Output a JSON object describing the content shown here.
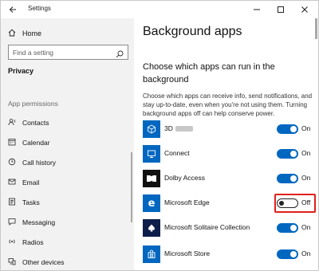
{
  "window": {
    "title": "Settings",
    "icons": {
      "back": "back-arrow-icon",
      "minimize": "minimize-icon",
      "maximize": "maximize-icon",
      "close": "close-icon"
    }
  },
  "sidebar": {
    "home": {
      "label": "Home",
      "icon": "home-icon"
    },
    "search": {
      "placeholder": "Find a setting",
      "icon": "search-icon"
    },
    "category": "Privacy",
    "section": "App permissions",
    "items": [
      {
        "label": "Contacts",
        "icon": "contacts-icon"
      },
      {
        "label": "Calendar",
        "icon": "calendar-icon"
      },
      {
        "label": "Call history",
        "icon": "call-history-icon"
      },
      {
        "label": "Email",
        "icon": "email-icon"
      },
      {
        "label": "Tasks",
        "icon": "tasks-icon"
      },
      {
        "label": "Messaging",
        "icon": "messaging-icon"
      },
      {
        "label": "Radios",
        "icon": "radios-icon"
      },
      {
        "label": "Other devices",
        "icon": "other-devices-icon"
      }
    ]
  },
  "main": {
    "title": "Background apps",
    "heading": "Choose which apps can run in the background",
    "description": "Choose which apps can receive info, send notifications, and stay up-to-date, even when you're not using them. Turning background apps off can help conserve power.",
    "apps": [
      {
        "name": "3D",
        "state": "On",
        "enabled": true,
        "tile_color": "#0067c0",
        "icon": "3d-viewer-icon"
      },
      {
        "name": "Connect",
        "state": "On",
        "enabled": true,
        "tile_color": "#0067c0",
        "icon": "connect-icon"
      },
      {
        "name": "Dolby Access",
        "state": "On",
        "enabled": true,
        "tile_color": "#111111",
        "icon": "dolby-icon"
      },
      {
        "name": "Microsoft Edge",
        "state": "Off",
        "enabled": false,
        "highlighted": true,
        "tile_color": "#0067c0",
        "icon": "edge-icon"
      },
      {
        "name": "Microsoft Solitaire Collection",
        "state": "On",
        "enabled": true,
        "tile_color": "#0d1e4a",
        "icon": "solitaire-icon"
      },
      {
        "name": "Microsoft Store",
        "state": "On",
        "enabled": true,
        "tile_color": "#0067c0",
        "icon": "store-icon"
      }
    ]
  },
  "colors": {
    "accent": "#0067c0",
    "sidebar_bg": "#f2f2f2",
    "highlight": "#e0201b"
  }
}
